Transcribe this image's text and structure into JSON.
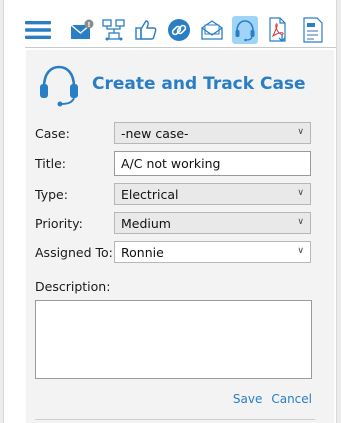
{
  "toolbar": {
    "icons": [
      {
        "name": "menu-icon"
      },
      {
        "name": "mail-icon"
      },
      {
        "name": "org-chart-icon"
      },
      {
        "name": "thumbs-up-icon"
      },
      {
        "name": "link-icon"
      },
      {
        "name": "open-envelope-icon"
      },
      {
        "name": "headset-icon",
        "active": true
      },
      {
        "name": "pdf-download-icon"
      },
      {
        "name": "form-icon"
      }
    ],
    "accent_color": "#2a7ec5",
    "active_bg": "#9fd4f7"
  },
  "header": {
    "title": "Create and Track Case",
    "icon": "headset-icon"
  },
  "form": {
    "case": {
      "label": "Case:",
      "value": "-new case-"
    },
    "title": {
      "label": "Title:",
      "value": "A/C not working"
    },
    "type": {
      "label": "Type:",
      "value": "Electrical"
    },
    "priority": {
      "label": "Priority:",
      "value": "Medium"
    },
    "assigned_to": {
      "label": "Assigned To:",
      "value": "Ronnie"
    },
    "description": {
      "label": "Description:",
      "value": ""
    }
  },
  "actions": {
    "save": "Save",
    "cancel": "Cancel"
  }
}
